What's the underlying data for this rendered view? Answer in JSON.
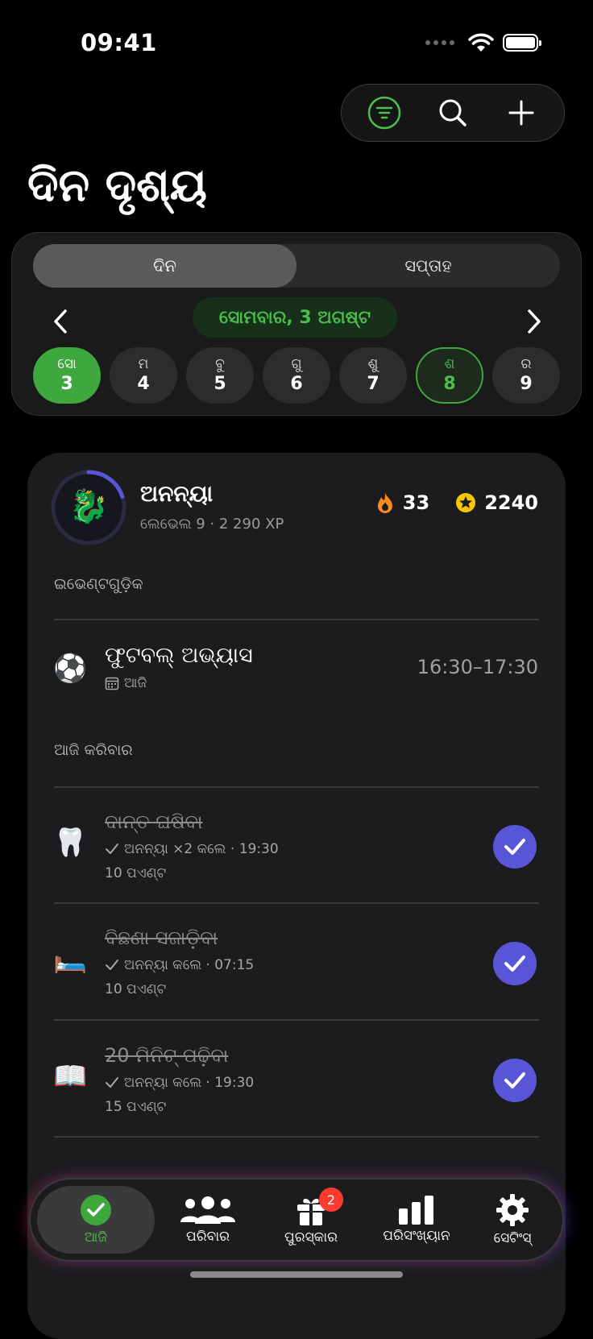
{
  "status": {
    "time": "09:41"
  },
  "page": {
    "title": "ଦିନ ଦୃଶ୍ୟ"
  },
  "view_toggle": {
    "options": [
      "ଦିନ",
      "ସପ୍ତାହ"
    ],
    "selected": "ଦିନ"
  },
  "date_nav": {
    "current_date": "ସୋମବାର, 3 ଅଗଷ୍ଟ"
  },
  "days": [
    {
      "name": "ସୋ",
      "num": "3",
      "state": "selected"
    },
    {
      "name": "ମ",
      "num": "4",
      "state": ""
    },
    {
      "name": "ବୁ",
      "num": "5",
      "state": ""
    },
    {
      "name": "ଗୁ",
      "num": "6",
      "state": ""
    },
    {
      "name": "ଶୁ",
      "num": "7",
      "state": ""
    },
    {
      "name": "ଶ",
      "num": "8",
      "state": "outlined"
    },
    {
      "name": "ର",
      "num": "9",
      "state": ""
    }
  ],
  "user": {
    "avatar_emoji": "🐉",
    "name": "ଅନନ୍ୟା",
    "level_text": "ଲେଭେଲ 9 · 2 290 XP",
    "level_progress": 0.2,
    "streak": "33",
    "points": "2240"
  },
  "events": {
    "label": "ଇଭେଣ୍ଟଗୁଡ଼ିକ",
    "items": [
      {
        "emoji": "⚽",
        "title": "ଫୁଟବଲ୍ ଅଭ୍ୟାସ",
        "sub": "ଆଜି",
        "time": "16:30–17:30"
      }
    ]
  },
  "todos": {
    "label": "ଆଜି କରିବାର",
    "items": [
      {
        "emoji": "🦷",
        "title": "ଦାନ୍ତ ଘଷିବା",
        "done_by": "ଅନନ୍ୟା ×2 କଲେ · 19:30",
        "points": "10 ପଏଣ୍ଟ",
        "done": true
      },
      {
        "emoji": "🛏️",
        "title": "ବିଛଣା ସଜାଡ଼ିବା",
        "done_by": "ଅନନ୍ୟା କଲେ · 07:15",
        "points": "10 ପଏଣ୍ଟ",
        "done": true
      },
      {
        "emoji": "📖",
        "title": "20 ମିନିଟ୍ ପଢ଼ିବା",
        "done_by": "ଅନନ୍ୟା କଲେ · 19:30",
        "points": "15 ପଏଣ୍ଟ",
        "done": true
      }
    ]
  },
  "tabbar": {
    "items": [
      {
        "label": "ଆଜି",
        "icon": "check-circle-icon",
        "active": true
      },
      {
        "label": "ପରିବାର",
        "icon": "people-icon"
      },
      {
        "label": "ପୁରସ୍କାର",
        "icon": "gift-icon",
        "badge": "2"
      },
      {
        "label": "ପରିସଂଖ୍ୟାନ",
        "icon": "bar-chart-icon"
      },
      {
        "label": "ସେଟିଂସ୍",
        "icon": "gear-icon"
      }
    ]
  },
  "colors": {
    "accent_green": "#3ea83e",
    "check_purple": "#5856d6",
    "badge_red": "#ff3b30"
  }
}
